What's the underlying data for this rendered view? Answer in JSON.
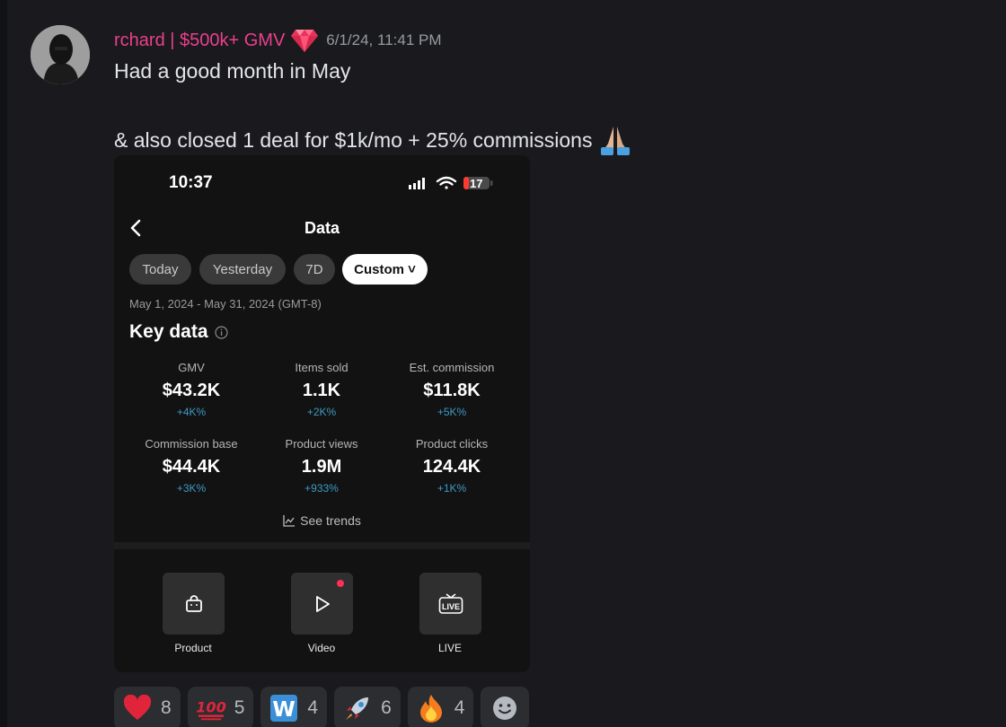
{
  "message": {
    "author": "rchard | $500k+ GMV",
    "timestamp": "6/1/24, 11:41 PM",
    "line1": "Had a good month in May",
    "line2": "& also closed 1 deal for $1k/mo + 25% commissions"
  },
  "phone": {
    "status_time": "10:37",
    "battery": "17",
    "title": "Data",
    "chips": [
      "Today",
      "Yesterday",
      "7D",
      "Custom"
    ],
    "chip_custom": "Custom ˅",
    "date_range": "May 1, 2024 - May 31, 2024 (GMT-8)",
    "key_data_title": "Key data",
    "metrics": [
      {
        "label": "GMV",
        "value": "$43.2K",
        "change": "+4K%"
      },
      {
        "label": "Items sold",
        "value": "1.1K",
        "change": "+2K%"
      },
      {
        "label": "Est. commission",
        "value": "$11.8K",
        "change": "+5K%"
      },
      {
        "label": "Commission base",
        "value": "$44.4K",
        "change": "+3K%"
      },
      {
        "label": "Product views",
        "value": "1.9M",
        "change": "+933%"
      },
      {
        "label": "Product clicks",
        "value": "124.4K",
        "change": "+1K%"
      }
    ],
    "see_trends": "See trends",
    "tools": [
      {
        "label": "Product",
        "icon": "shopping-bag-icon"
      },
      {
        "label": "Video",
        "icon": "play-icon"
      },
      {
        "label": "LIVE",
        "icon": "live-tv-icon"
      }
    ]
  },
  "reactions": [
    {
      "emoji": "red-heart",
      "count": "8"
    },
    {
      "emoji": "hundred-points",
      "count": "5"
    },
    {
      "emoji": "letter-w",
      "count": "4"
    },
    {
      "emoji": "rocket",
      "count": "6"
    },
    {
      "emoji": "fire",
      "count": "4"
    }
  ],
  "colors": {
    "background": "#1a1a1e",
    "username": "#ec3f8d",
    "change": "#3d9ac4",
    "reaction_bg": "#2b2d31"
  }
}
